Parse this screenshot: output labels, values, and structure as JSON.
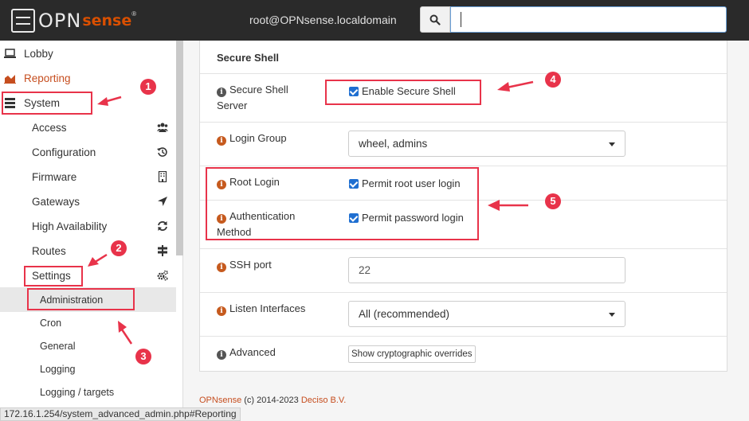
{
  "header": {
    "logo_text": "OPN",
    "logo_accent": "sense",
    "logo_reg": "®",
    "user": "root@OPNsense.localdomain",
    "search_placeholder": ""
  },
  "sidebar": {
    "top_items": [
      {
        "label": "Lobby",
        "icon": "laptop-icon"
      },
      {
        "label": "Reporting",
        "icon": "area-chart-icon"
      },
      {
        "label": "System",
        "icon": "server-icon"
      }
    ],
    "system_items": [
      {
        "label": "Access",
        "icon": "users-icon"
      },
      {
        "label": "Configuration",
        "icon": "history-icon"
      },
      {
        "label": "Firmware",
        "icon": "building-icon"
      },
      {
        "label": "Gateways",
        "icon": "location-arrow-icon"
      },
      {
        "label": "High Availability",
        "icon": "refresh-icon"
      },
      {
        "label": "Routes",
        "icon": "map-signs-icon"
      },
      {
        "label": "Settings",
        "icon": "cogs-icon"
      }
    ],
    "settings_items": [
      {
        "label": "Administration",
        "active": true
      },
      {
        "label": "Cron"
      },
      {
        "label": "General"
      },
      {
        "label": "Logging"
      },
      {
        "label": "Logging / targets"
      }
    ]
  },
  "panel": {
    "title": "Secure Shell",
    "rows": [
      {
        "label": "Secure Shell Server",
        "control": "checkbox",
        "text": "Enable Secure Shell",
        "checked": true
      },
      {
        "label": "Login Group",
        "control": "select",
        "value": "wheel, admins"
      },
      {
        "label": "Root Login",
        "control": "checkbox",
        "text": "Permit root user login",
        "checked": true
      },
      {
        "label": "Authentication Method",
        "control": "checkbox",
        "text": "Permit password login",
        "checked": true
      },
      {
        "label": "SSH port",
        "control": "text",
        "value": "22"
      },
      {
        "label": "Listen Interfaces",
        "control": "select",
        "value": "All (recommended)"
      },
      {
        "label": "Advanced",
        "control": "button",
        "text": "Show cryptographic overrides"
      }
    ]
  },
  "footer": {
    "brand": "OPNsense",
    "copyright": " (c) 2014-2023 ",
    "company": "Deciso B.V."
  },
  "statusbar": {
    "url": "172.16.1.254/system_advanced_admin.php#Reporting"
  },
  "annotations": {
    "badges": [
      "1",
      "2",
      "3",
      "4",
      "5"
    ],
    "color": "#e8334a"
  },
  "colors": {
    "topbar": "#2a2a2a",
    "accent": "#d94f00",
    "checkbox": "#1f6fd1",
    "info_icon": "#c65a1e"
  }
}
